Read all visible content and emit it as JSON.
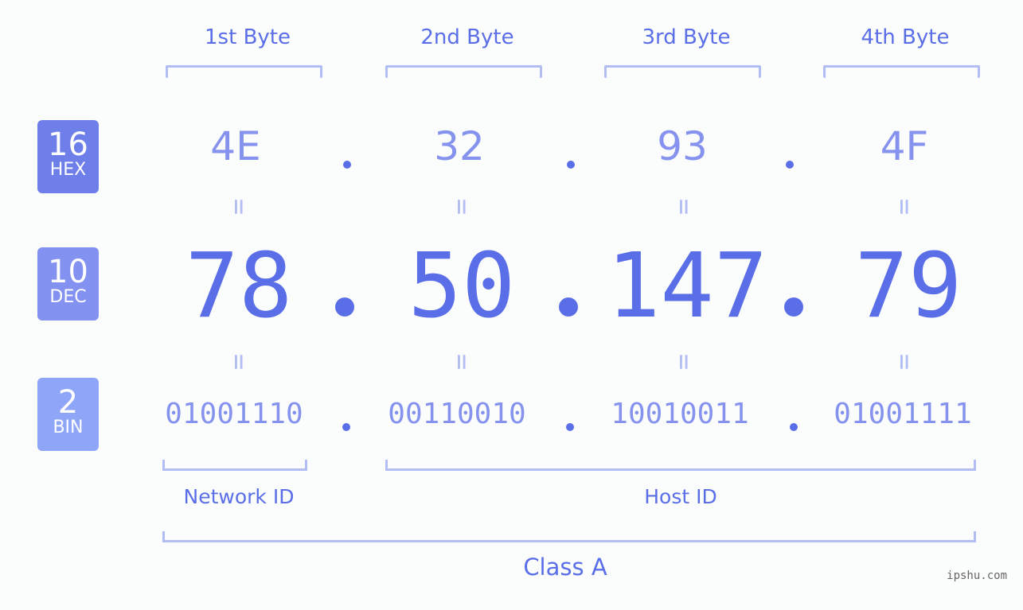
{
  "bytes": [
    {
      "label": "1st Byte",
      "hex": "4E",
      "dec": "78",
      "bin": "01001110"
    },
    {
      "label": "2nd Byte",
      "hex": "32",
      "dec": "50",
      "bin": "00110010"
    },
    {
      "label": "3rd Byte",
      "hex": "93",
      "dec": "147",
      "bin": "10010011"
    },
    {
      "label": "4th Byte",
      "hex": "4F",
      "dec": "79",
      "bin": "01001111"
    }
  ],
  "badges": {
    "hex": {
      "base": "16",
      "name": "HEX",
      "color": "#6f7fe9"
    },
    "dec": {
      "base": "10",
      "name": "DEC",
      "color": "#8392f1"
    },
    "bin": {
      "base": "2",
      "name": "BIN",
      "color": "#8fa5f8"
    }
  },
  "equals": "=",
  "network_id_label": "Network ID",
  "host_id_label": "Host ID",
  "class_label": "Class A",
  "watermark": "ipshu.com",
  "colors": {
    "primary": "#5a6ee8",
    "light": "#8592ee",
    "bracket": "#b3bdf5"
  }
}
